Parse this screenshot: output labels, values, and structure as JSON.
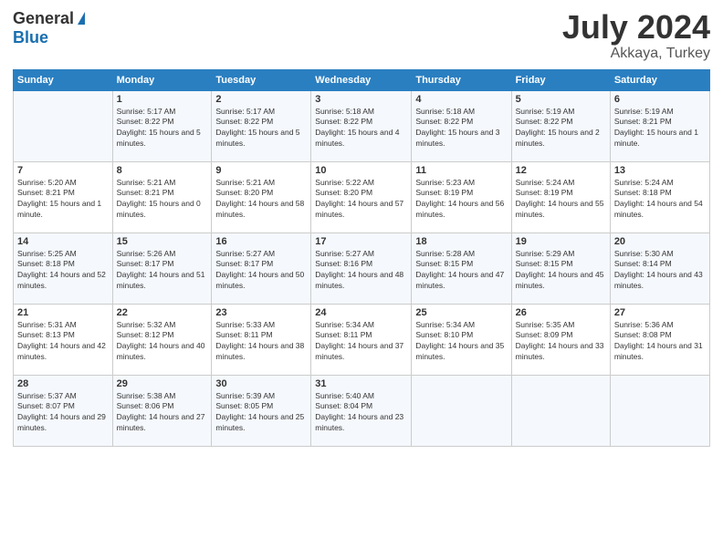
{
  "logo": {
    "general": "General",
    "blue": "Blue"
  },
  "title": {
    "month_year": "July 2024",
    "location": "Akkaya, Turkey"
  },
  "weekdays": [
    "Sunday",
    "Monday",
    "Tuesday",
    "Wednesday",
    "Thursday",
    "Friday",
    "Saturday"
  ],
  "weeks": [
    [
      {
        "day": "",
        "sunrise": "",
        "sunset": "",
        "daylight": ""
      },
      {
        "day": "1",
        "sunrise": "Sunrise: 5:17 AM",
        "sunset": "Sunset: 8:22 PM",
        "daylight": "Daylight: 15 hours and 5 minutes."
      },
      {
        "day": "2",
        "sunrise": "Sunrise: 5:17 AM",
        "sunset": "Sunset: 8:22 PM",
        "daylight": "Daylight: 15 hours and 5 minutes."
      },
      {
        "day": "3",
        "sunrise": "Sunrise: 5:18 AM",
        "sunset": "Sunset: 8:22 PM",
        "daylight": "Daylight: 15 hours and 4 minutes."
      },
      {
        "day": "4",
        "sunrise": "Sunrise: 5:18 AM",
        "sunset": "Sunset: 8:22 PM",
        "daylight": "Daylight: 15 hours and 3 minutes."
      },
      {
        "day": "5",
        "sunrise": "Sunrise: 5:19 AM",
        "sunset": "Sunset: 8:22 PM",
        "daylight": "Daylight: 15 hours and 2 minutes."
      },
      {
        "day": "6",
        "sunrise": "Sunrise: 5:19 AM",
        "sunset": "Sunset: 8:21 PM",
        "daylight": "Daylight: 15 hours and 1 minute."
      }
    ],
    [
      {
        "day": "7",
        "sunrise": "Sunrise: 5:20 AM",
        "sunset": "Sunset: 8:21 PM",
        "daylight": "Daylight: 15 hours and 1 minute."
      },
      {
        "day": "8",
        "sunrise": "Sunrise: 5:21 AM",
        "sunset": "Sunset: 8:21 PM",
        "daylight": "Daylight: 15 hours and 0 minutes."
      },
      {
        "day": "9",
        "sunrise": "Sunrise: 5:21 AM",
        "sunset": "Sunset: 8:20 PM",
        "daylight": "Daylight: 14 hours and 58 minutes."
      },
      {
        "day": "10",
        "sunrise": "Sunrise: 5:22 AM",
        "sunset": "Sunset: 8:20 PM",
        "daylight": "Daylight: 14 hours and 57 minutes."
      },
      {
        "day": "11",
        "sunrise": "Sunrise: 5:23 AM",
        "sunset": "Sunset: 8:19 PM",
        "daylight": "Daylight: 14 hours and 56 minutes."
      },
      {
        "day": "12",
        "sunrise": "Sunrise: 5:24 AM",
        "sunset": "Sunset: 8:19 PM",
        "daylight": "Daylight: 14 hours and 55 minutes."
      },
      {
        "day": "13",
        "sunrise": "Sunrise: 5:24 AM",
        "sunset": "Sunset: 8:18 PM",
        "daylight": "Daylight: 14 hours and 54 minutes."
      }
    ],
    [
      {
        "day": "14",
        "sunrise": "Sunrise: 5:25 AM",
        "sunset": "Sunset: 8:18 PM",
        "daylight": "Daylight: 14 hours and 52 minutes."
      },
      {
        "day": "15",
        "sunrise": "Sunrise: 5:26 AM",
        "sunset": "Sunset: 8:17 PM",
        "daylight": "Daylight: 14 hours and 51 minutes."
      },
      {
        "day": "16",
        "sunrise": "Sunrise: 5:27 AM",
        "sunset": "Sunset: 8:17 PM",
        "daylight": "Daylight: 14 hours and 50 minutes."
      },
      {
        "day": "17",
        "sunrise": "Sunrise: 5:27 AM",
        "sunset": "Sunset: 8:16 PM",
        "daylight": "Daylight: 14 hours and 48 minutes."
      },
      {
        "day": "18",
        "sunrise": "Sunrise: 5:28 AM",
        "sunset": "Sunset: 8:15 PM",
        "daylight": "Daylight: 14 hours and 47 minutes."
      },
      {
        "day": "19",
        "sunrise": "Sunrise: 5:29 AM",
        "sunset": "Sunset: 8:15 PM",
        "daylight": "Daylight: 14 hours and 45 minutes."
      },
      {
        "day": "20",
        "sunrise": "Sunrise: 5:30 AM",
        "sunset": "Sunset: 8:14 PM",
        "daylight": "Daylight: 14 hours and 43 minutes."
      }
    ],
    [
      {
        "day": "21",
        "sunrise": "Sunrise: 5:31 AM",
        "sunset": "Sunset: 8:13 PM",
        "daylight": "Daylight: 14 hours and 42 minutes."
      },
      {
        "day": "22",
        "sunrise": "Sunrise: 5:32 AM",
        "sunset": "Sunset: 8:12 PM",
        "daylight": "Daylight: 14 hours and 40 minutes."
      },
      {
        "day": "23",
        "sunrise": "Sunrise: 5:33 AM",
        "sunset": "Sunset: 8:11 PM",
        "daylight": "Daylight: 14 hours and 38 minutes."
      },
      {
        "day": "24",
        "sunrise": "Sunrise: 5:34 AM",
        "sunset": "Sunset: 8:11 PM",
        "daylight": "Daylight: 14 hours and 37 minutes."
      },
      {
        "day": "25",
        "sunrise": "Sunrise: 5:34 AM",
        "sunset": "Sunset: 8:10 PM",
        "daylight": "Daylight: 14 hours and 35 minutes."
      },
      {
        "day": "26",
        "sunrise": "Sunrise: 5:35 AM",
        "sunset": "Sunset: 8:09 PM",
        "daylight": "Daylight: 14 hours and 33 minutes."
      },
      {
        "day": "27",
        "sunrise": "Sunrise: 5:36 AM",
        "sunset": "Sunset: 8:08 PM",
        "daylight": "Daylight: 14 hours and 31 minutes."
      }
    ],
    [
      {
        "day": "28",
        "sunrise": "Sunrise: 5:37 AM",
        "sunset": "Sunset: 8:07 PM",
        "daylight": "Daylight: 14 hours and 29 minutes."
      },
      {
        "day": "29",
        "sunrise": "Sunrise: 5:38 AM",
        "sunset": "Sunset: 8:06 PM",
        "daylight": "Daylight: 14 hours and 27 minutes."
      },
      {
        "day": "30",
        "sunrise": "Sunrise: 5:39 AM",
        "sunset": "Sunset: 8:05 PM",
        "daylight": "Daylight: 14 hours and 25 minutes."
      },
      {
        "day": "31",
        "sunrise": "Sunrise: 5:40 AM",
        "sunset": "Sunset: 8:04 PM",
        "daylight": "Daylight: 14 hours and 23 minutes."
      },
      {
        "day": "",
        "sunrise": "",
        "sunset": "",
        "daylight": ""
      },
      {
        "day": "",
        "sunrise": "",
        "sunset": "",
        "daylight": ""
      },
      {
        "day": "",
        "sunrise": "",
        "sunset": "",
        "daylight": ""
      }
    ]
  ]
}
